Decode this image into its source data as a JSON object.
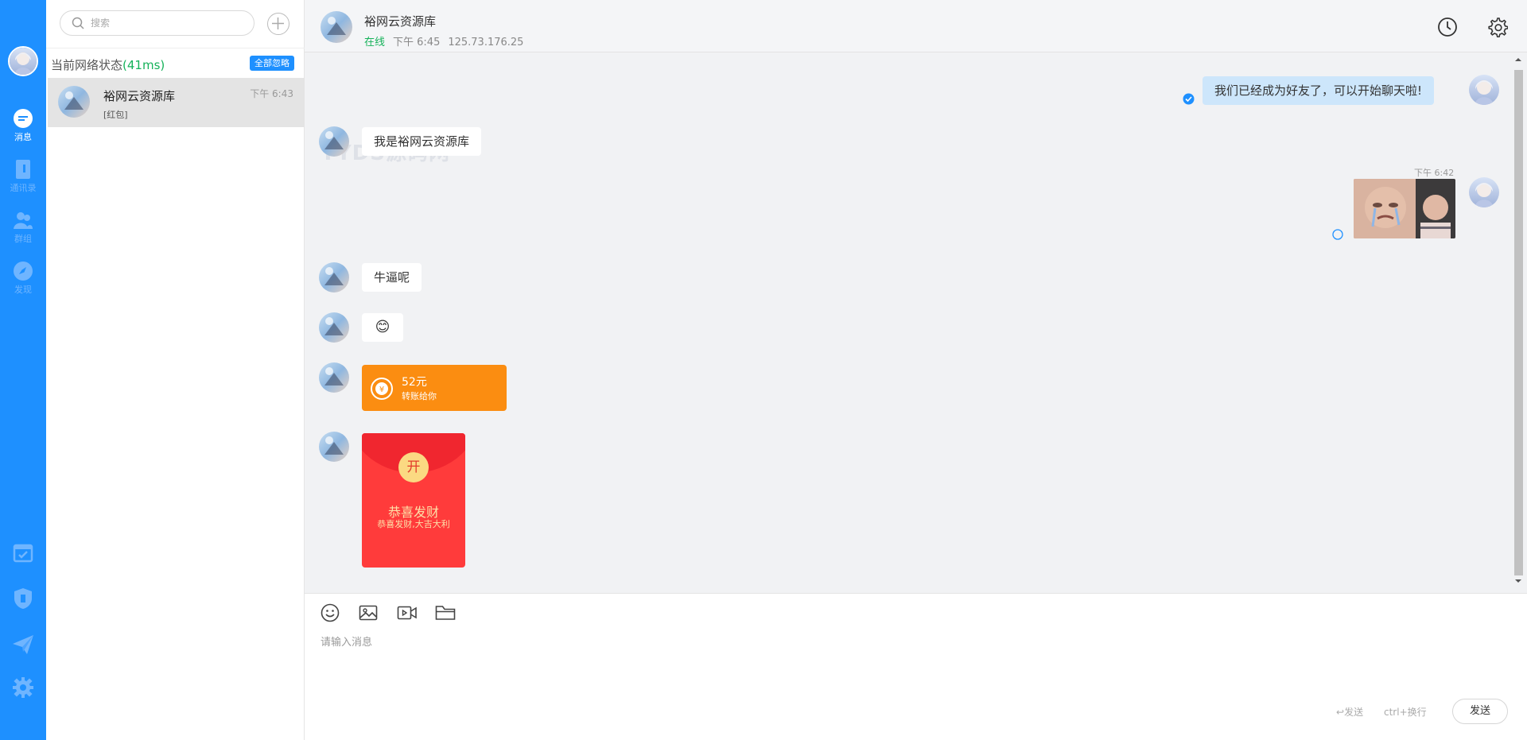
{
  "sidebar": {
    "items": [
      {
        "label": "消息"
      },
      {
        "label": "通讯录"
      },
      {
        "label": "群组"
      },
      {
        "label": "发现"
      }
    ]
  },
  "conversations": {
    "search_placeholder": "搜索",
    "network_status_label": "当前网络状态",
    "network_latency": "(41ms)",
    "ignore_all_label": "全部忽略",
    "items": [
      {
        "name": "裕网云资源库",
        "time": "下午 6:43",
        "preview": "[红包]"
      }
    ]
  },
  "chat": {
    "title": "裕网云资源库",
    "status": "在线",
    "time": "下午 6:45",
    "ip": "125.73.176.25",
    "watermark": "YYDS源码网",
    "messages": {
      "m1_text": "我们已经成为好友了，可以开始聊天啦!",
      "m2_text": "我是裕网云资源库",
      "m3_time": "下午 6:42",
      "m4_text": "牛逼呢",
      "m5_emoji": "😊",
      "transfer_amount": "52元",
      "transfer_desc": "转账给你",
      "redpack_open": "开",
      "redpack_title": "恭喜发财",
      "redpack_sub": "恭喜发财,大吉大利"
    }
  },
  "composer": {
    "placeholder": "请输入消息",
    "send_hint": "发送",
    "newline_hint": "ctrl+换行",
    "send_label": "发送"
  },
  "colors": {
    "rail": "#1e90ff",
    "online": "#16b25a",
    "transfer": "#fb8d11",
    "redpack": "#ff3b3b"
  }
}
